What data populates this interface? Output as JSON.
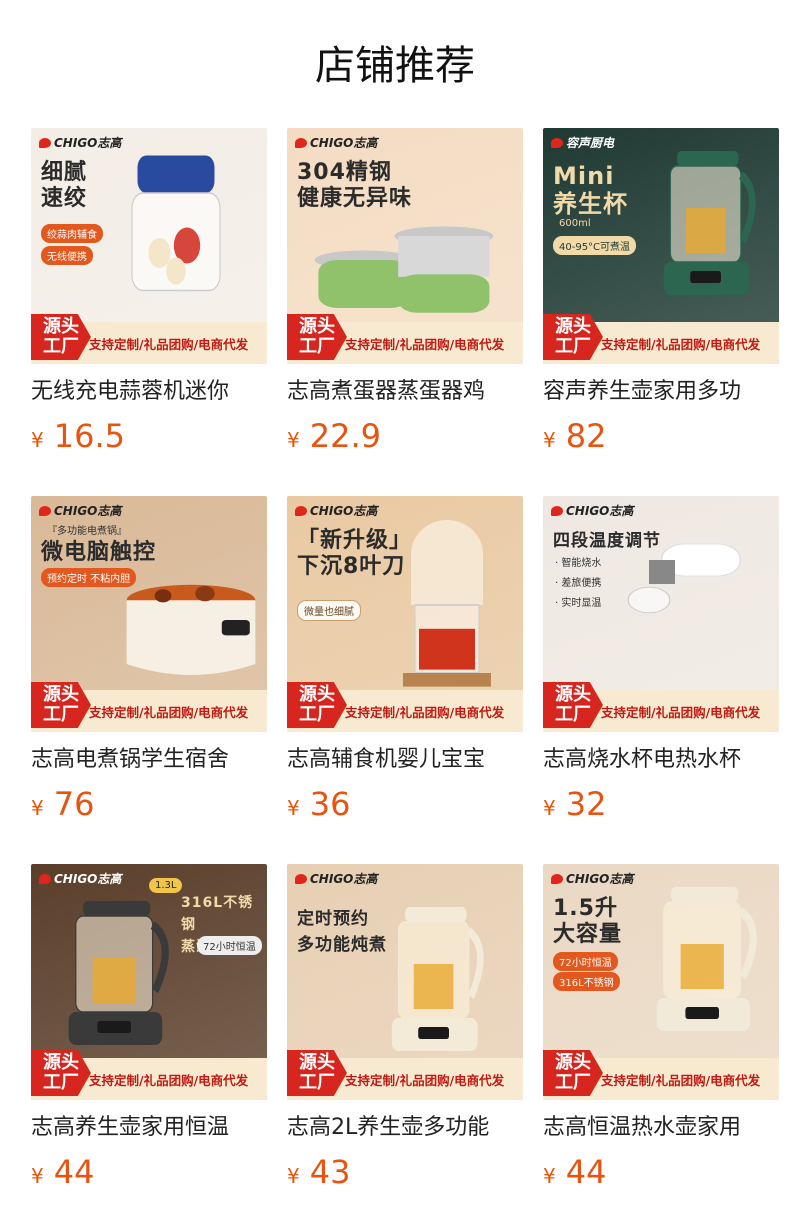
{
  "header": {
    "title": "店铺推荐"
  },
  "footer_band": {
    "source_line1": "源头",
    "source_line2": "工厂",
    "slogan": "支持定制/礼品团购/电商代发"
  },
  "currency_symbol": "¥",
  "products": [
    {
      "name": "无线充电蒜蓉机迷你",
      "price": "16.5",
      "brand": "CHIGO志高",
      "headline": "细腻\n速绞",
      "chips": [
        "绞蒜肉辅食",
        "无线便携"
      ],
      "bg": "#f3ede6",
      "accent": "#2a4aa0"
    },
    {
      "name": "志高煮蛋器蒸蛋器鸡",
      "price": "22.9",
      "brand": "CHIGO志高",
      "headline": "304精钢\n健康无异味",
      "chips": [],
      "bg": "#f4dcc2",
      "accent": "#8fc26a"
    },
    {
      "name": "容声养生壶家用多功",
      "price": "82",
      "brand": "容声厨电",
      "headline": "Mini\n养生杯",
      "chips": [
        "600ml",
        "40-95°C可煮温"
      ],
      "bg": "#1f3a33",
      "accent": "#2d6650"
    },
    {
      "name": "志高电煮锅学生宿舍",
      "price": "76",
      "brand": "CHIGO志高",
      "headline": "微电脑触控",
      "chips": [
        "『多功能电煮锅』",
        "预约定时 不粘内胆"
      ],
      "bg": "#d9b997",
      "accent": "#f5efe4"
    },
    {
      "name": "志高辅食机婴儿宝宝",
      "price": "36",
      "brand": "CHIGO志高",
      "headline": "「新升级」\n下沉8叶刀",
      "chips": [
        "微量也细腻"
      ],
      "bg": "#e9c9a2",
      "accent": "#f6e7d2"
    },
    {
      "name": "志高烧水杯电热水杯",
      "price": "32",
      "brand": "CHIGO志高",
      "headline": "四段温度调节",
      "chips": [],
      "bullets": [
        "· 智能烧水",
        "· 差旅便携",
        "· 实时显温"
      ],
      "bg": "#efe8e2",
      "accent": "#ffffff"
    },
    {
      "name": "志高养生壶家用恒温",
      "price": "44",
      "brand": "CHIGO志高",
      "headline": "316L不锈钢\n蒸汽喷淋",
      "chips": [
        "1.3L",
        "72小时恒温"
      ],
      "bg": "#5a3e2a",
      "accent": "#3a3a3a"
    },
    {
      "name": "志高2L养生壶多功能",
      "price": "43",
      "brand": "CHIGO志高",
      "headline": "定时预约\n多功能炖煮",
      "chips": [],
      "bg": "#e7cfb3",
      "accent": "#f3ead8"
    },
    {
      "name": "志高恒温热水壶家用",
      "price": "44",
      "brand": "CHIGO志高",
      "headline": "1.5升\n大容量",
      "chips": [
        "72小时恒温",
        "316L不锈钢"
      ],
      "bg": "#ead8c3",
      "accent": "#f2ead8"
    }
  ]
}
